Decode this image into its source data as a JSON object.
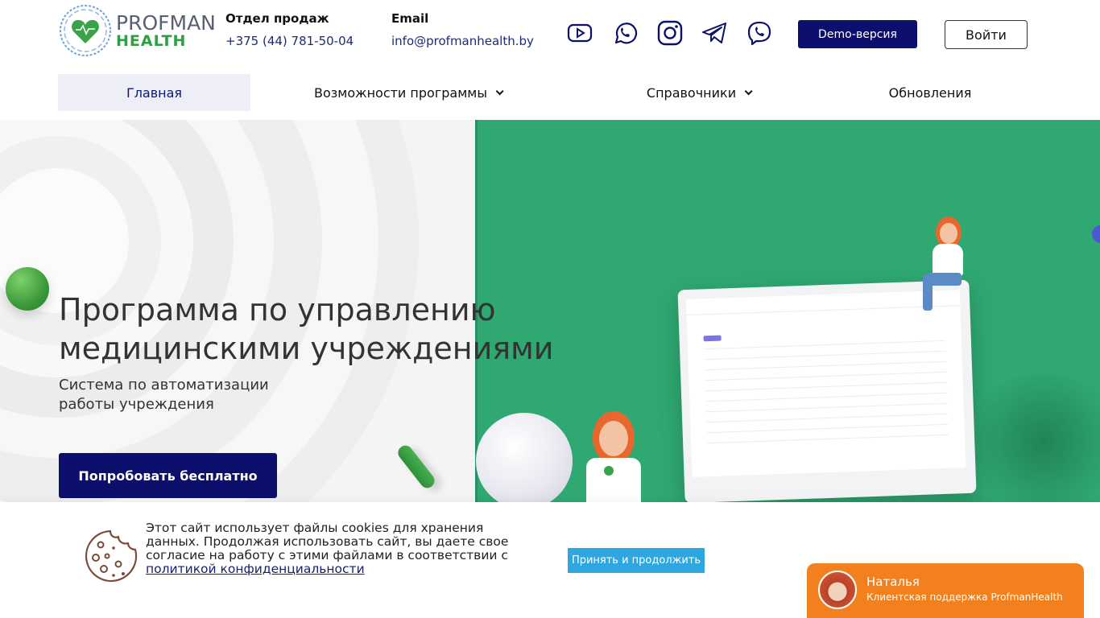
{
  "logo": {
    "line1": "PROFMAN",
    "line2": "HEALTH"
  },
  "contacts": {
    "sales": {
      "label": "Отдел продаж",
      "value": "+375 (44) 781-50-04"
    },
    "email": {
      "label": "Email",
      "value": "info@profmanhealth.by"
    }
  },
  "social_icons": [
    "youtube-icon",
    "whatsapp-icon",
    "instagram-icon",
    "telegram-icon",
    "viber-icon"
  ],
  "buttons": {
    "demo": "Demo-версия",
    "login": "Войти",
    "try": "Попробовать бесплатно"
  },
  "nav": {
    "items": [
      {
        "label": "Главная",
        "active": true
      },
      {
        "label": "Возможности программы",
        "dropdown": true
      },
      {
        "label": "Справочники",
        "dropdown": true
      },
      {
        "label": "Обновления"
      }
    ]
  },
  "hero": {
    "title_line1": "Программа по управлению",
    "title_line2": "медицинскими учреждениями",
    "subtitle": "Система по автоматизации работы учреждения"
  },
  "cookie": {
    "text": "Этот сайт использует файлы cookies для хранения данных. Продолжая использовать сайт, вы даете свое согласие на работу с этими файлами в соответствии с",
    "link": "политикой конфиденциальности",
    "accept": "Принять и продолжить"
  },
  "chat": {
    "name": "Наталья",
    "role": "Клиентская поддержка ProfmanHealth"
  },
  "colors": {
    "brand_dark": "#0c0f6b",
    "brand_green": "#2fa871",
    "accent_blue": "#2ea7e0",
    "chat_orange": "#f2801e"
  }
}
